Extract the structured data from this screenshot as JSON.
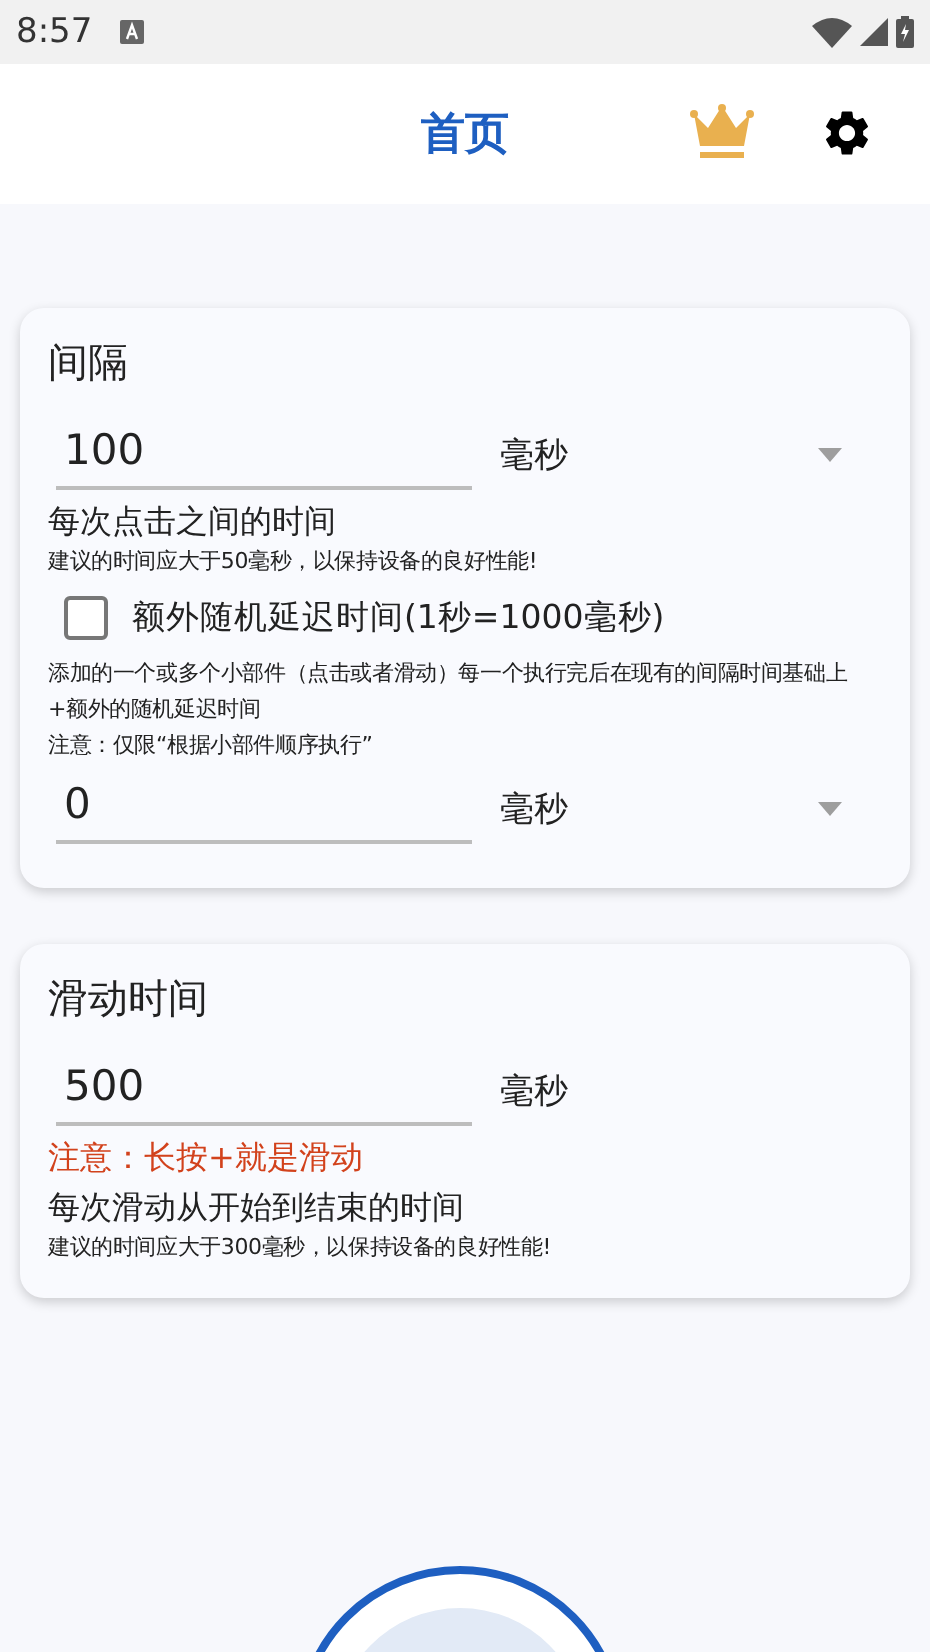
{
  "status_bar": {
    "time": "8:57"
  },
  "app_bar": {
    "title": "首页"
  },
  "cards": [
    {
      "title": "间隔",
      "items": [
        {
          "kind": "dropdown_field",
          "value": "100",
          "unit": "毫秒"
        },
        {
          "kind": "heading",
          "text": "每次点击之间的时间"
        },
        {
          "kind": "hint",
          "text": "建议的时间应大于50毫秒，以保持设备的良好性能!"
        },
        {
          "kind": "checkbox",
          "label": "额外随机延迟时间(1秒=1000毫秒)",
          "checked": false
        },
        {
          "kind": "hint",
          "text": "添加的一个或多个小部件（点击或者滑动）每一个执行完后在现有的间隔时间基础上+额外的随机延迟时间"
        },
        {
          "kind": "hint",
          "text": "注意：仅限“根据小部件顺序执行”"
        },
        {
          "kind": "dropdown_field",
          "value": "0",
          "unit": "毫秒"
        }
      ]
    },
    {
      "title": "滑动时间",
      "items": [
        {
          "kind": "plain_field",
          "value": "500",
          "unit": "毫秒"
        },
        {
          "kind": "warning",
          "text": "注意：长按+就是滑动"
        },
        {
          "kind": "heading",
          "text": "每次滑动从开始到结束的时间"
        },
        {
          "kind": "hint",
          "text": "建议的时间应大于300毫秒，以保持设备的良好性能!"
        }
      ]
    }
  ]
}
